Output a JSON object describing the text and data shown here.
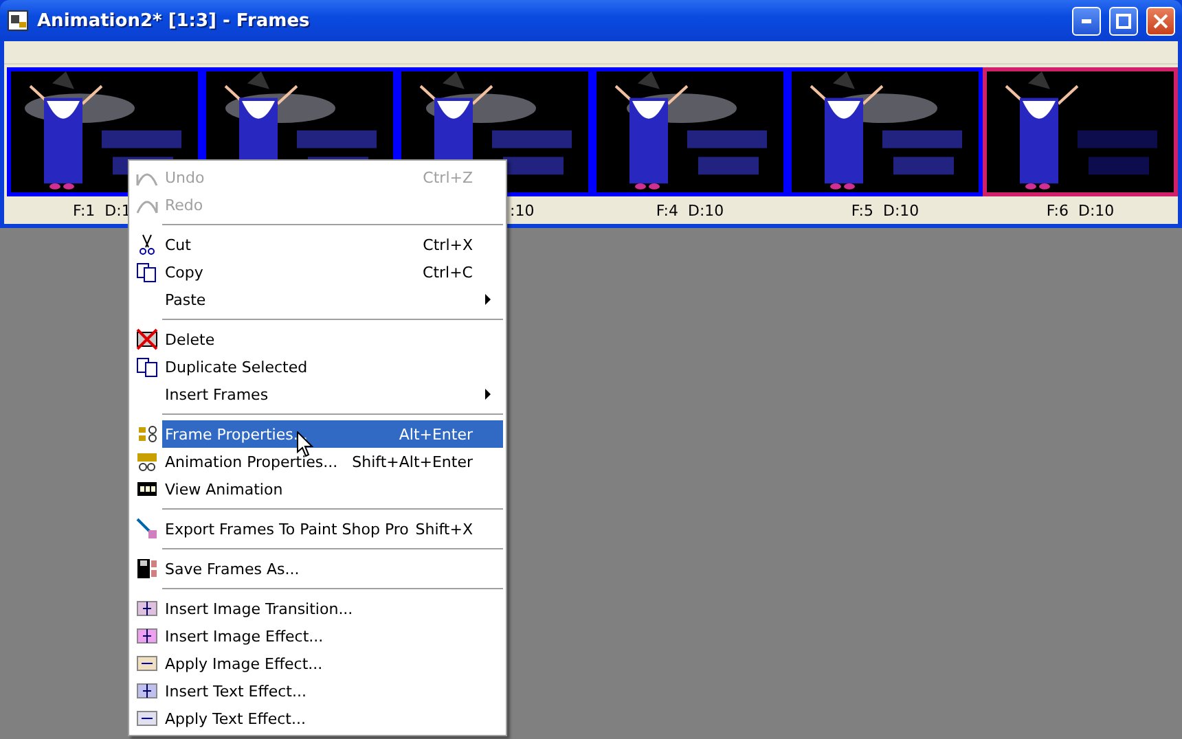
{
  "window": {
    "title": "Animation2* [1:3] - Frames"
  },
  "frames": [
    {
      "caption": "F:1  D:1",
      "selected": true
    },
    {
      "selected": true
    },
    {
      "caption": ":10",
      "selected": true
    },
    {
      "caption": "F:4  D:10",
      "selected": true
    },
    {
      "caption": "F:5  D:10",
      "selected": true
    },
    {
      "caption": "F:6  D:10",
      "selected": false
    }
  ],
  "context_menu": [
    {
      "kind": "item",
      "label": "Undo",
      "shortcut": "Ctrl+Z",
      "disabled": true,
      "selected": false
    },
    {
      "kind": "item",
      "label": "Redo",
      "disabled": true,
      "selected": false
    },
    {
      "kind": "separator"
    },
    {
      "kind": "item",
      "label": "Cut",
      "shortcut": "Ctrl+X",
      "disabled": false,
      "selected": false
    },
    {
      "kind": "item",
      "label": "Copy",
      "shortcut": "Ctrl+C",
      "disabled": false,
      "selected": false
    },
    {
      "kind": "item",
      "label": "Paste",
      "submenu": true,
      "disabled": false,
      "selected": false
    },
    {
      "kind": "separator"
    },
    {
      "kind": "item",
      "label": "Delete",
      "disabled": false,
      "selected": false
    },
    {
      "kind": "item",
      "label": "Duplicate Selected",
      "disabled": false,
      "selected": false
    },
    {
      "kind": "item",
      "label": "Insert Frames",
      "submenu": true,
      "disabled": false,
      "selected": false
    },
    {
      "kind": "separator"
    },
    {
      "kind": "item",
      "label": "Frame Properties...",
      "shortcut": "Alt+Enter",
      "disabled": false,
      "selected": true
    },
    {
      "kind": "item",
      "label": "Animation Properties...",
      "shortcut": "Shift+Alt+Enter",
      "disabled": false,
      "selected": false
    },
    {
      "kind": "item",
      "label": "View Animation",
      "disabled": false,
      "selected": false
    },
    {
      "kind": "separator"
    },
    {
      "kind": "item",
      "label": "Export Frames To Paint Shop Pro",
      "shortcut": "Shift+X",
      "disabled": false,
      "selected": false
    },
    {
      "kind": "separator"
    },
    {
      "kind": "item",
      "label": "Save Frames As...",
      "disabled": false,
      "selected": false
    },
    {
      "kind": "separator"
    },
    {
      "kind": "item",
      "label": "Insert Image Transition...",
      "disabled": false,
      "selected": false
    },
    {
      "kind": "item",
      "label": "Insert Image Effect...",
      "disabled": false,
      "selected": false
    },
    {
      "kind": "item",
      "label": "Apply Image Effect...",
      "disabled": false,
      "selected": false
    },
    {
      "kind": "item",
      "label": "Insert Text Effect...",
      "disabled": false,
      "selected": false
    },
    {
      "kind": "item",
      "label": "Apply Text Effect...",
      "disabled": false,
      "selected": false
    }
  ]
}
